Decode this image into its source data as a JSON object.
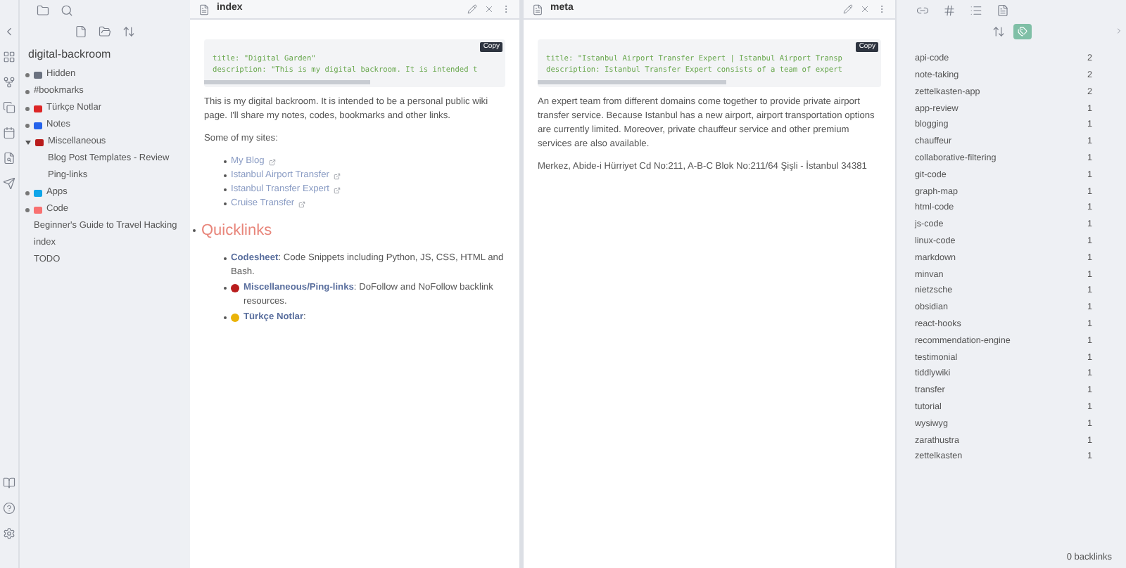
{
  "sidebar": {
    "vault": "digital-backroom",
    "tree": [
      {
        "label": "Hidden",
        "kind": "folder",
        "expanded": false,
        "color": "#6b7280"
      },
      {
        "label": "#bookmarks",
        "kind": "folder",
        "expanded": false
      },
      {
        "label": "Türkçe Notlar",
        "kind": "folder",
        "expanded": false,
        "color": "#dc2626"
      },
      {
        "label": "Notes",
        "kind": "folder",
        "expanded": false,
        "color": "#2563eb"
      },
      {
        "label": "Miscellaneous",
        "kind": "folder",
        "expanded": true,
        "color": "#b91c1c",
        "children": [
          {
            "label": "Blog Post Templates - Review",
            "kind": "file"
          },
          {
            "label": "Ping-links",
            "kind": "file"
          }
        ]
      },
      {
        "label": "Apps",
        "kind": "folder",
        "expanded": false,
        "color": "#0ea5e9"
      },
      {
        "label": "Code",
        "kind": "folder",
        "expanded": false,
        "color": "#f87171"
      },
      {
        "label": "Beginner's Guide to Travel Hacking",
        "kind": "file"
      },
      {
        "label": "index",
        "kind": "file"
      },
      {
        "label": "TODO",
        "kind": "file"
      }
    ]
  },
  "panes": [
    {
      "title": "index",
      "copy": "Copy",
      "code": [
        "title: \"Digital Garden\"",
        "description: \"This is my digital backroom. It is intended t"
      ],
      "blocks": [
        {
          "kind": "para",
          "text": "This is my digital backroom. It is intended to be a personal public wiki page. I'll share my notes, codes, bookmarks and other links."
        },
        {
          "kind": "para",
          "text": "Some of my sites:"
        },
        {
          "kind": "links",
          "items": [
            "My Blog",
            "Istanbul Airport Transfer",
            "Istanbul Transfer Expert",
            "Cruise Transfer"
          ]
        },
        {
          "kind": "heading",
          "text": "Quicklinks"
        },
        {
          "kind": "quick",
          "items": [
            {
              "link": "Codesheet",
              "text": ": Code Snippets including Python, JS, CSS, HTML and Bash."
            },
            {
              "link": "Miscellaneous/Ping-links",
              "text": ": DoFollow and NoFollow backlink resources.",
              "color": "#b91c1c"
            },
            {
              "link": "Türkçe Notlar",
              "text": ":",
              "color": "#eab308"
            }
          ]
        }
      ]
    },
    {
      "title": "meta",
      "copy": "Copy",
      "code": [
        "title: \"Istanbul Airport Transfer Expert | Istanbul Airport Transp",
        "description: Istanbul Transfer Expert consists of a team of expert"
      ],
      "blocks": [
        {
          "kind": "para",
          "text": "An expert team from different domains come together to provide private airport transfer service. Because Istanbul has a new airport, airport transportation options are currently limited. Moreover, private chauffeur service and other premium services are also available."
        },
        {
          "kind": "para",
          "text": "Merkez, Abide-i Hürriyet Cd No:211, A-B-C Blok No:211/64 Şişli - İstanbul 34381"
        }
      ]
    }
  ],
  "tags": [
    {
      "name": "api-code",
      "count": "2"
    },
    {
      "name": "note-taking",
      "count": "2"
    },
    {
      "name": "zettelkasten-app",
      "count": "2"
    },
    {
      "name": "app-review",
      "count": "1"
    },
    {
      "name": "blogging",
      "count": "1"
    },
    {
      "name": "chauffeur",
      "count": "1"
    },
    {
      "name": "collaborative-filtering",
      "count": "1"
    },
    {
      "name": "git-code",
      "count": "1"
    },
    {
      "name": "graph-map",
      "count": "1"
    },
    {
      "name": "html-code",
      "count": "1"
    },
    {
      "name": "js-code",
      "count": "1"
    },
    {
      "name": "linux-code",
      "count": "1"
    },
    {
      "name": "markdown",
      "count": "1"
    },
    {
      "name": "minvan",
      "count": "1"
    },
    {
      "name": "nietzsche",
      "count": "1"
    },
    {
      "name": "obsidian",
      "count": "1"
    },
    {
      "name": "react-hooks",
      "count": "1"
    },
    {
      "name": "recommendation-engine",
      "count": "1"
    },
    {
      "name": "testimonial",
      "count": "1"
    },
    {
      "name": "tiddlywiki",
      "count": "1"
    },
    {
      "name": "transfer",
      "count": "1"
    },
    {
      "name": "tutorial",
      "count": "1"
    },
    {
      "name": "wysiwyg",
      "count": "1"
    },
    {
      "name": "zarathustra",
      "count": "1"
    },
    {
      "name": "zettelkasten",
      "count": "1"
    }
  ],
  "status_bar": {
    "backlinks": "0 backlinks"
  }
}
